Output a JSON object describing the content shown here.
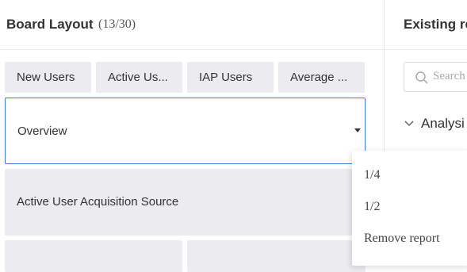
{
  "board": {
    "title": "Board Layout",
    "count": "(13/30)",
    "chips": [
      "New Users",
      "Active Us...",
      "IAP Users",
      "Average ..."
    ],
    "selected_view": "Overview",
    "widgets": [
      "Active User Acquisition Source"
    ]
  },
  "existing": {
    "title": "Existing re",
    "search_placeholder": "Search",
    "section_label": "Analysi"
  },
  "context_menu": {
    "items": [
      "1/4",
      "1/2",
      "Remove report"
    ]
  },
  "colors": {
    "accent": "#3a7bd5",
    "chip_bg": "#ebebf0"
  }
}
